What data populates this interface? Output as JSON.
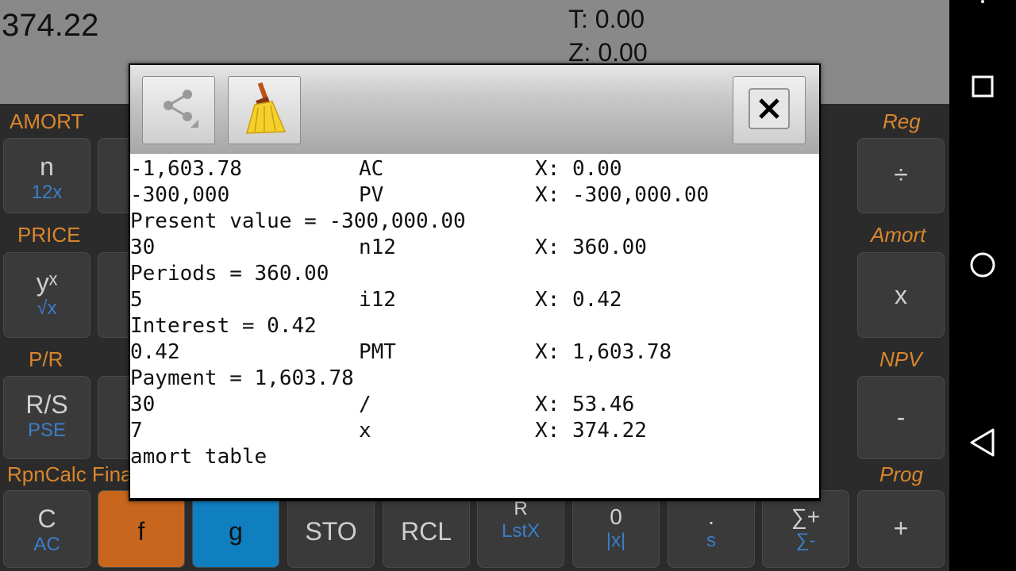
{
  "display": {
    "x": "374.22",
    "t": "T: 0.00",
    "z": "Z: 0.00"
  },
  "row_labels": {
    "amort": "AMORT",
    "reg": "Reg",
    "price": "PRICE",
    "amort2": "Amort",
    "pr": "P/R",
    "npv": "NPV",
    "rpncalc": "RpnCalc Fina",
    "prog": "Prog"
  },
  "keys": {
    "n": {
      "main": "n",
      "sub": "12x"
    },
    "div": {
      "main": "÷"
    },
    "yx": {
      "main": "yˣ",
      "sub": "√x"
    },
    "mul": {
      "main": "x"
    },
    "rs": {
      "main": "R/S",
      "sub": "PSE"
    },
    "minus": {
      "main": "-"
    },
    "c": {
      "main": "C",
      "sub": "AC"
    },
    "f": {
      "main": "f"
    },
    "g": {
      "main": "g"
    },
    "sto": {
      "main": "STO"
    },
    "rcl": {
      "main": "RCL"
    },
    "rv": {
      "main": "R",
      "sub": "LstX"
    },
    "zero": {
      "main": "0",
      "sub": "|x|"
    },
    "dot": {
      "main": ".",
      "sub": "s"
    },
    "sigma": {
      "main": "∑+",
      "sub": "∑-"
    },
    "plus": {
      "main": "+"
    }
  },
  "dialog": {
    "share_icon": "share-icon",
    "clear_icon": "broom-icon",
    "close_icon": "close-icon",
    "log": [
      {
        "a": "-1,603.78",
        "b": "AC",
        "c": "X: 0.00"
      },
      {
        "a": "-300,000",
        "b": "PV",
        "c": "X: -300,000.00"
      },
      {
        "a": "Present value = -300,000.00",
        "b": "",
        "c": ""
      },
      {
        "a": "30",
        "b": "n12",
        "c": "X: 360.00"
      },
      {
        "a": "Periods = 360.00",
        "b": "",
        "c": ""
      },
      {
        "a": "5",
        "b": "i12",
        "c": "X: 0.42"
      },
      {
        "a": "Interest = 0.42",
        "b": "",
        "c": ""
      },
      {
        "a": "0.42",
        "b": "PMT",
        "c": "X: 1,603.78"
      },
      {
        "a": "Payment = 1,603.78",
        "b": "",
        "c": ""
      },
      {
        "a": "30",
        "b": "/",
        "c": "X: 53.46"
      },
      {
        "a": "7",
        "b": "x",
        "c": "X: 374.22"
      },
      {
        "a": "amort table",
        "b": "",
        "c": ""
      }
    ]
  },
  "nav": {
    "back": "back-icon",
    "home": "home-icon",
    "recents": "recents-icon"
  }
}
